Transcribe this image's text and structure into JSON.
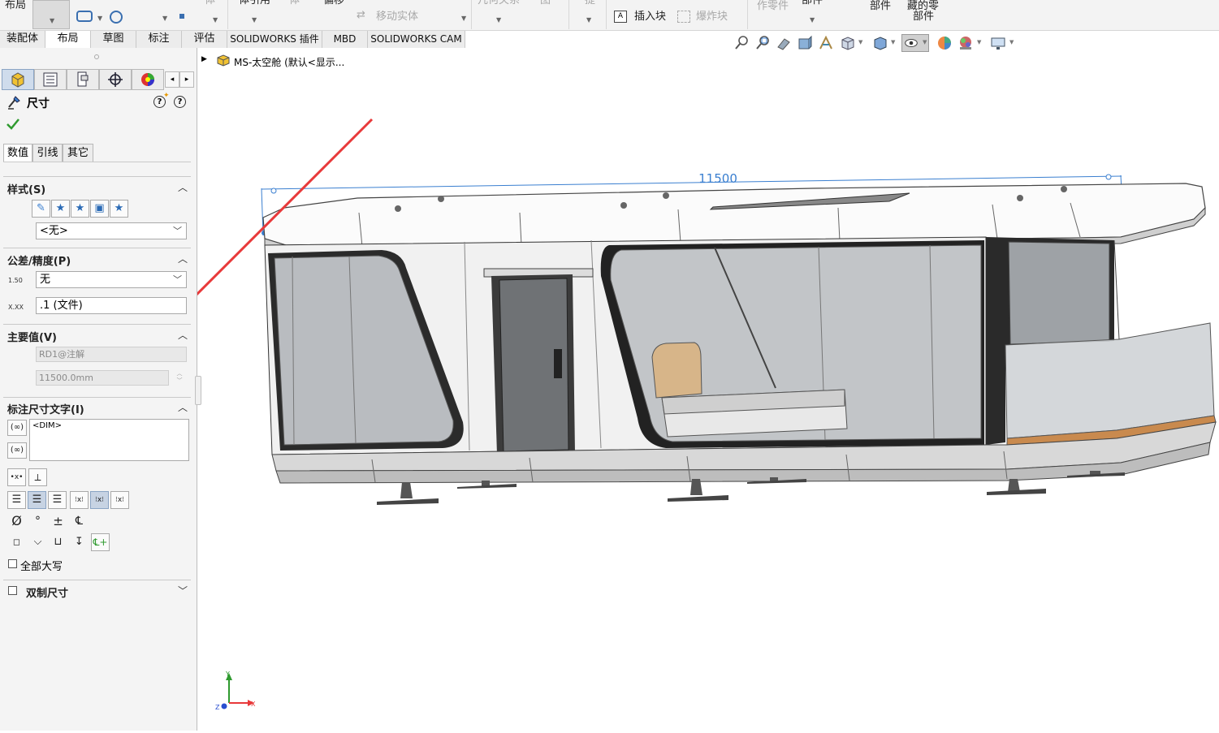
{
  "ribbon": {
    "items": [
      {
        "label": "布局"
      },
      {
        "label": "体引用"
      },
      {
        "label": "偏移"
      },
      {
        "label": "移动实体"
      },
      {
        "label": "体"
      },
      {
        "label": "几何关系"
      },
      {
        "label": "图"
      },
      {
        "label": "插入块"
      },
      {
        "label": "爆炸块"
      },
      {
        "label": "作零件"
      },
      {
        "label": "部件"
      },
      {
        "label": "部件"
      },
      {
        "label": "藏的零"
      },
      {
        "label": "部件"
      }
    ]
  },
  "tabs": [
    {
      "label": "装配体"
    },
    {
      "label": "布局"
    },
    {
      "label": "草图"
    },
    {
      "label": "标注"
    },
    {
      "label": "评估"
    },
    {
      "label": "SOLIDWORKS 插件"
    },
    {
      "label": "MBD"
    },
    {
      "label": "SOLIDWORKS CAM"
    }
  ],
  "tree": {
    "root_label": "MS-太空舱 (默认<显示..."
  },
  "property_manager": {
    "title": "尺寸",
    "subtabs": [
      "数值",
      "引线",
      "其它"
    ],
    "style": {
      "title": "样式(S)",
      "selected": "<无>"
    },
    "tolerance": {
      "title": "公差/精度(P)",
      "tolerance_value": "无",
      "precision_value": ".1 (文件)",
      "tol_icon_text": "1.50",
      "prec_icon_text": "X.XX"
    },
    "primary_value": {
      "title": "主要值(V)",
      "name": "RD1@注解",
      "value": "11500.0mm"
    },
    "dim_text": {
      "title": "标注尺寸文字(I)",
      "content": "<DIM>"
    },
    "all_caps_label": "全部大写",
    "dual_dim_label": "双制尺寸"
  },
  "viewport": {
    "dimension_text": "11500",
    "dimension_color": "#3a7fd0",
    "annotation_arrow_color": "#e8393a",
    "triad": {
      "y": "Y",
      "x": "X",
      "z": "Z"
    }
  },
  "colors": {
    "panel_bg": "#f4f4f4",
    "accent_blue": "#3a7fd0",
    "checkmark_green": "#2f9a2f"
  }
}
